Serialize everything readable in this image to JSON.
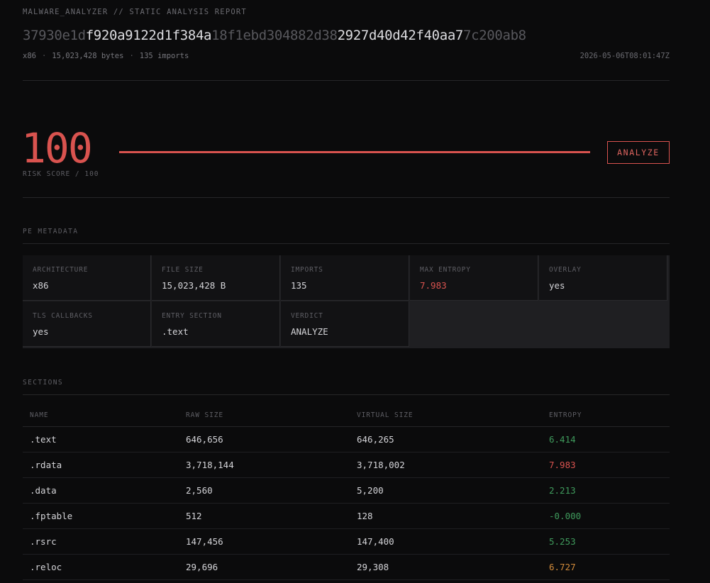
{
  "header": {
    "title": "MALWARE_ANALYZER // STATIC ANALYSIS REPORT",
    "hash_parts": [
      {
        "text": "37930e1d",
        "style": "dim"
      },
      {
        "text": "f920a9122d1f384a",
        "style": "hi"
      },
      {
        "text": "18f1ebd304882d38",
        "style": "dim"
      },
      {
        "text": "2927d40d42f40aa7",
        "style": "hi"
      },
      {
        "text": "7c200ab8",
        "style": "dim"
      }
    ],
    "arch": "x86",
    "size": "15,023,428 bytes",
    "imports": "135 imports",
    "separator": "·",
    "timestamp": "2026-05-06T08:01:47Z"
  },
  "risk": {
    "score": "100",
    "label": "RISK SCORE / 100",
    "fraction": 1.0,
    "button_label": "ANALYZE",
    "color": "#d9534f"
  },
  "pe_metadata": {
    "title": "PE METADATA",
    "cells": [
      {
        "key": "ARCHITECTURE",
        "value": "x86",
        "alert": false
      },
      {
        "key": "FILE SIZE",
        "value": "15,023,428 B",
        "alert": false
      },
      {
        "key": "IMPORTS",
        "value": "135",
        "alert": false
      },
      {
        "key": "MAX ENTROPY",
        "value": "7.983",
        "alert": true
      },
      {
        "key": "OVERLAY",
        "value": "yes",
        "alert": false
      },
      {
        "key": "TLS CALLBACKS",
        "value": "yes",
        "alert": false
      },
      {
        "key": "ENTRY SECTION",
        "value": ".text",
        "alert": false
      },
      {
        "key": "VERDICT",
        "value": "ANALYZE",
        "alert": false
      }
    ]
  },
  "sections": {
    "title": "SECTIONS",
    "columns": [
      "NAME",
      "RAW SIZE",
      "VIRTUAL SIZE",
      "ENTROPY"
    ],
    "rows": [
      {
        "name": ".text",
        "raw": "646,656",
        "virtual": "646,265",
        "entropy": "6.414",
        "level": "green"
      },
      {
        "name": ".rdata",
        "raw": "3,718,144",
        "virtual": "3,718,002",
        "entropy": "7.983",
        "level": "red"
      },
      {
        "name": ".data",
        "raw": "2,560",
        "virtual": "5,200",
        "entropy": "2.213",
        "level": "green"
      },
      {
        "name": ".fptable",
        "raw": "512",
        "virtual": "128",
        "entropy": "-0.000",
        "level": "green"
      },
      {
        "name": ".rsrc",
        "raw": "147,456",
        "virtual": "147,400",
        "entropy": "5.253",
        "level": "green"
      },
      {
        "name": ".reloc",
        "raw": "29,696",
        "virtual": "29,308",
        "entropy": "6.727",
        "level": "orange"
      }
    ]
  }
}
